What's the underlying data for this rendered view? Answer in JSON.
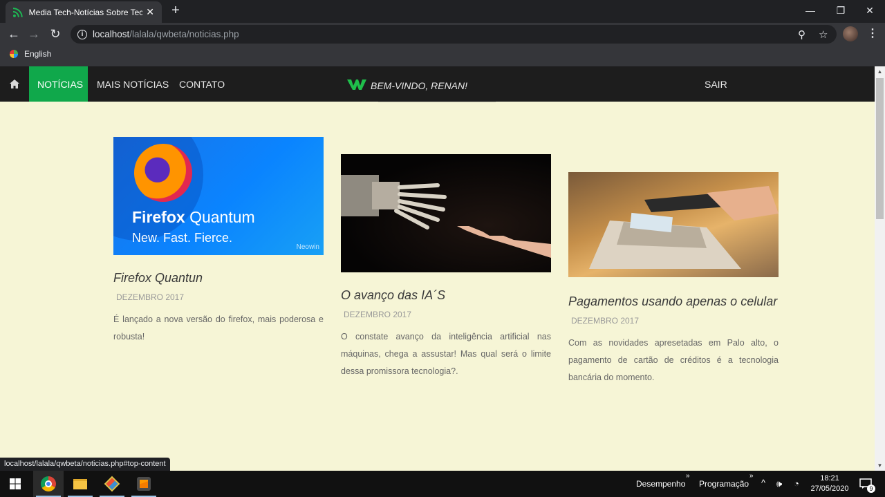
{
  "browser": {
    "tab_title": "Media Tech-Notícias Sobre Tecnologia",
    "url_host": "localhost",
    "url_path": "/lalala/qwbeta/noticias.php",
    "bookmark": "English",
    "status_link": "localhost/lalala/qwbeta/noticias.php#top-content"
  },
  "nav": {
    "items": [
      "NOTÍCIAS",
      "MAIS NOTÍCIAS",
      "CONTATO"
    ],
    "welcome": "BEM-VINDO, RENAN!",
    "logout": "SAIR",
    "accent": "#10a84b"
  },
  "articles": [
    {
      "title": "Firefox Quantun",
      "date": "DEZEMBRO 2017",
      "text": "É lançado a nova versão do firefox, mais poderosa e robusta!",
      "image": {
        "brand": "Firefox",
        "product": "Quantum",
        "tagline": "New. Fast. Fierce.",
        "watermark": "Neowin"
      }
    },
    {
      "title": "O avanço das IA´S",
      "date": "DEZEMBRO 2017",
      "text": "O constate avanço da inteligência artificial nas máquinas, chega a assustar! Mas qual será o limite dessa promissora tecnologia?.",
      "image": {}
    },
    {
      "title": "Pagamentos usando apenas o celular",
      "date": "DEZEMBRO 2017",
      "text": "Com as novidades apresetadas em Palo alto, o pagamento de cartão de créditos é a tecnologia bancária do momento.",
      "image": {}
    }
  ],
  "taskbar": {
    "toolbar1": "Desempenho",
    "toolbar2": "Programação",
    "time": "18:21",
    "date": "27/05/2020",
    "notifications": "9"
  }
}
